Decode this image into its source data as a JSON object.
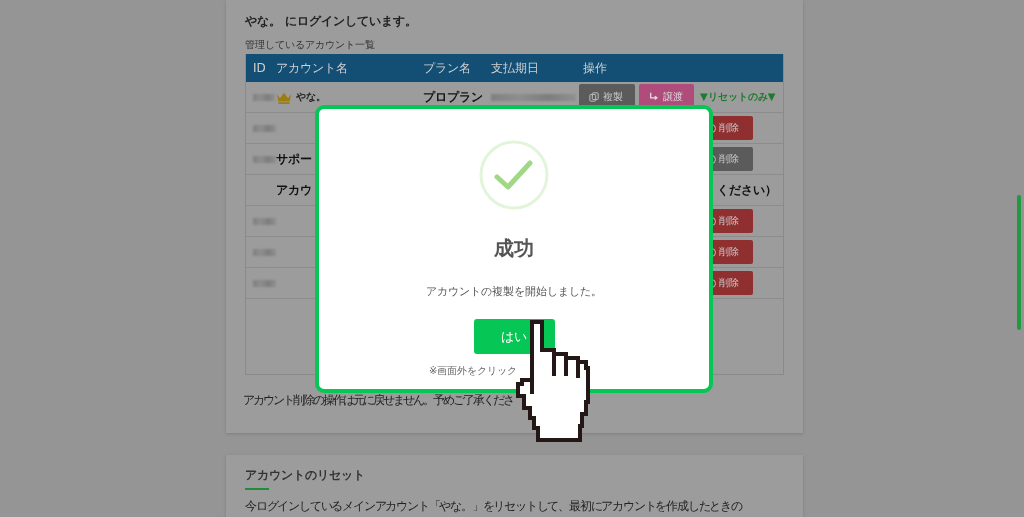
{
  "account_card": {
    "login_status": "やな。 にログインしています。",
    "list_title": "管理しているアカウント一覧",
    "table": {
      "columns": [
        "ID",
        "アカウント名",
        "プラン名",
        "支払期日",
        "操作"
      ],
      "rows": [
        {
          "kind": "owner",
          "name": "やな。",
          "plan": "プロプラン",
          "actions": [
            {
              "kind": "copy",
              "label": "複製"
            },
            {
              "kind": "transfer",
              "label": "譲渡"
            }
          ],
          "reset": "▼リセットのみ▼"
        },
        {
          "kind": "member",
          "delete": {
            "label": "削除",
            "disabled": false
          }
        },
        {
          "kind": "member",
          "name": "サポー",
          "delete": {
            "label": "削除",
            "disabled": true
          }
        },
        {
          "kind": "note",
          "text_start": "アカウ",
          "text_end": "ください）"
        },
        {
          "kind": "member",
          "delete": {
            "label": "削除",
            "disabled": false
          }
        },
        {
          "kind": "member",
          "delete": {
            "label": "削除",
            "disabled": false
          }
        },
        {
          "kind": "member",
          "delete": {
            "label": "削除",
            "disabled": false
          }
        }
      ]
    },
    "footnote": "アカウント削除の操作は元に戻せません。予めご了承くださ"
  },
  "reset_card": {
    "title": "アカウントのリセット",
    "text": "今ログインしているメインアカウント「やな。」をリセットして、最初にアカウントを作成したときの"
  },
  "dialog": {
    "title": "成功",
    "message": "アカウントの複製を開始しました。",
    "button": "はい",
    "hint": "※画面外をクリック"
  }
}
